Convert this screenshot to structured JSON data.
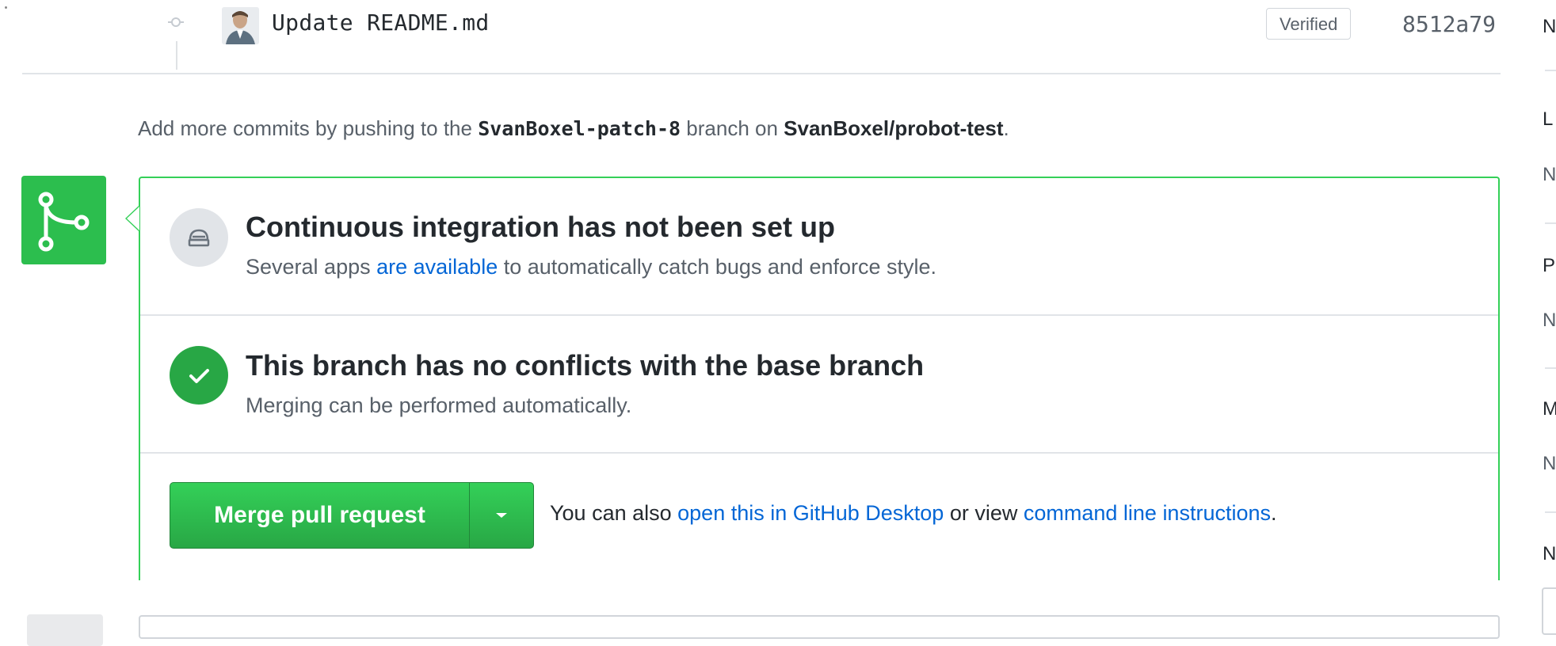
{
  "commit": {
    "message": "Update README.md",
    "verified_label": "Verified",
    "sha": "8512a79"
  },
  "push_info": {
    "prefix": "Add more commits by pushing to the ",
    "branch": "SvanBoxel-patch-8",
    "middle": " branch on ",
    "repo": "SvanBoxel/probot-test",
    "suffix": "."
  },
  "ci": {
    "title": "Continuous integration has not been set up",
    "sub_prefix": "Several apps ",
    "sub_link": "are available",
    "sub_suffix": " to automatically catch bugs and enforce style."
  },
  "conflicts": {
    "title": "This branch has no conflicts with the base branch",
    "sub": "Merging can be performed automatically."
  },
  "merge": {
    "button_label": "Merge pull request",
    "also_prefix": "You can also ",
    "desktop_link": "open this in GitHub Desktop",
    "also_middle": " or view ",
    "cli_link": "command line instructions",
    "also_suffix": "."
  },
  "sidebar_letters": [
    "N",
    "L",
    "N",
    "P",
    "N",
    "M",
    "N",
    "N"
  ],
  "colors": {
    "success_green": "#28a745",
    "link_blue": "#0366d6",
    "border_gray": "#e1e4e8"
  },
  "icons": [
    "commit-dot-icon",
    "git-merge-icon",
    "ci-icon",
    "check-icon",
    "dropdown-caret-icon"
  ]
}
